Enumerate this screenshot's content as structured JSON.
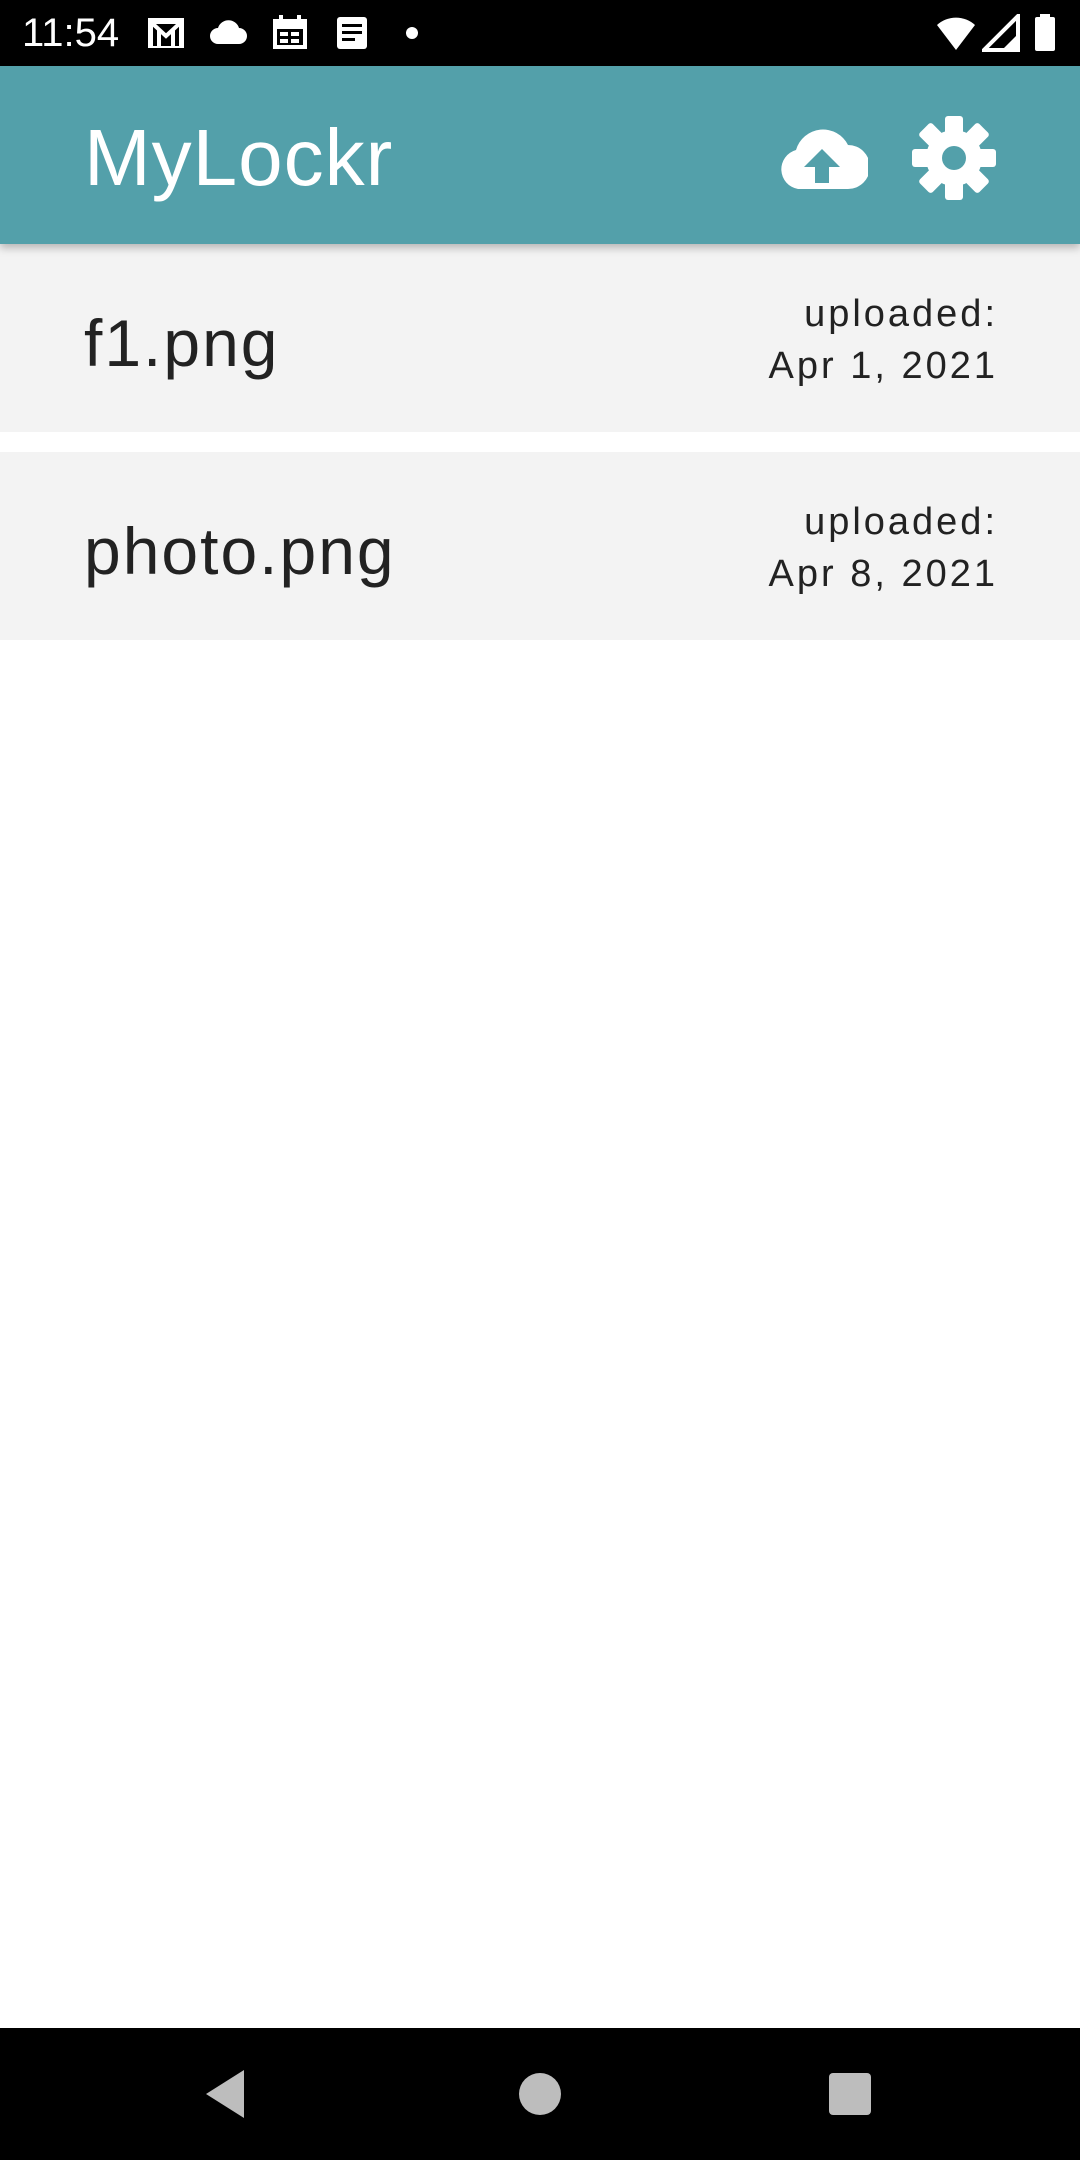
{
  "status_bar": {
    "time": "11:54",
    "left_icons": [
      "gmail-icon",
      "cloud-icon",
      "calendar-icon",
      "document-icon",
      "notification-dot-icon"
    ],
    "right_icons": [
      "wifi-icon",
      "cellular-signal-icon",
      "battery-icon"
    ]
  },
  "app_bar": {
    "title": "MyLockr",
    "actions": [
      "cloud-upload-icon",
      "settings-gear-icon"
    ],
    "color": "#53a0aa"
  },
  "files": [
    {
      "name": "f1.png",
      "uploaded_label": "uploaded:",
      "date": "Apr 1, 2021"
    },
    {
      "name": "photo.png",
      "uploaded_label": "uploaded:",
      "date": "Apr 8, 2021"
    }
  ],
  "nav_bar": {
    "buttons": [
      "back-icon",
      "home-icon",
      "recents-icon"
    ]
  }
}
